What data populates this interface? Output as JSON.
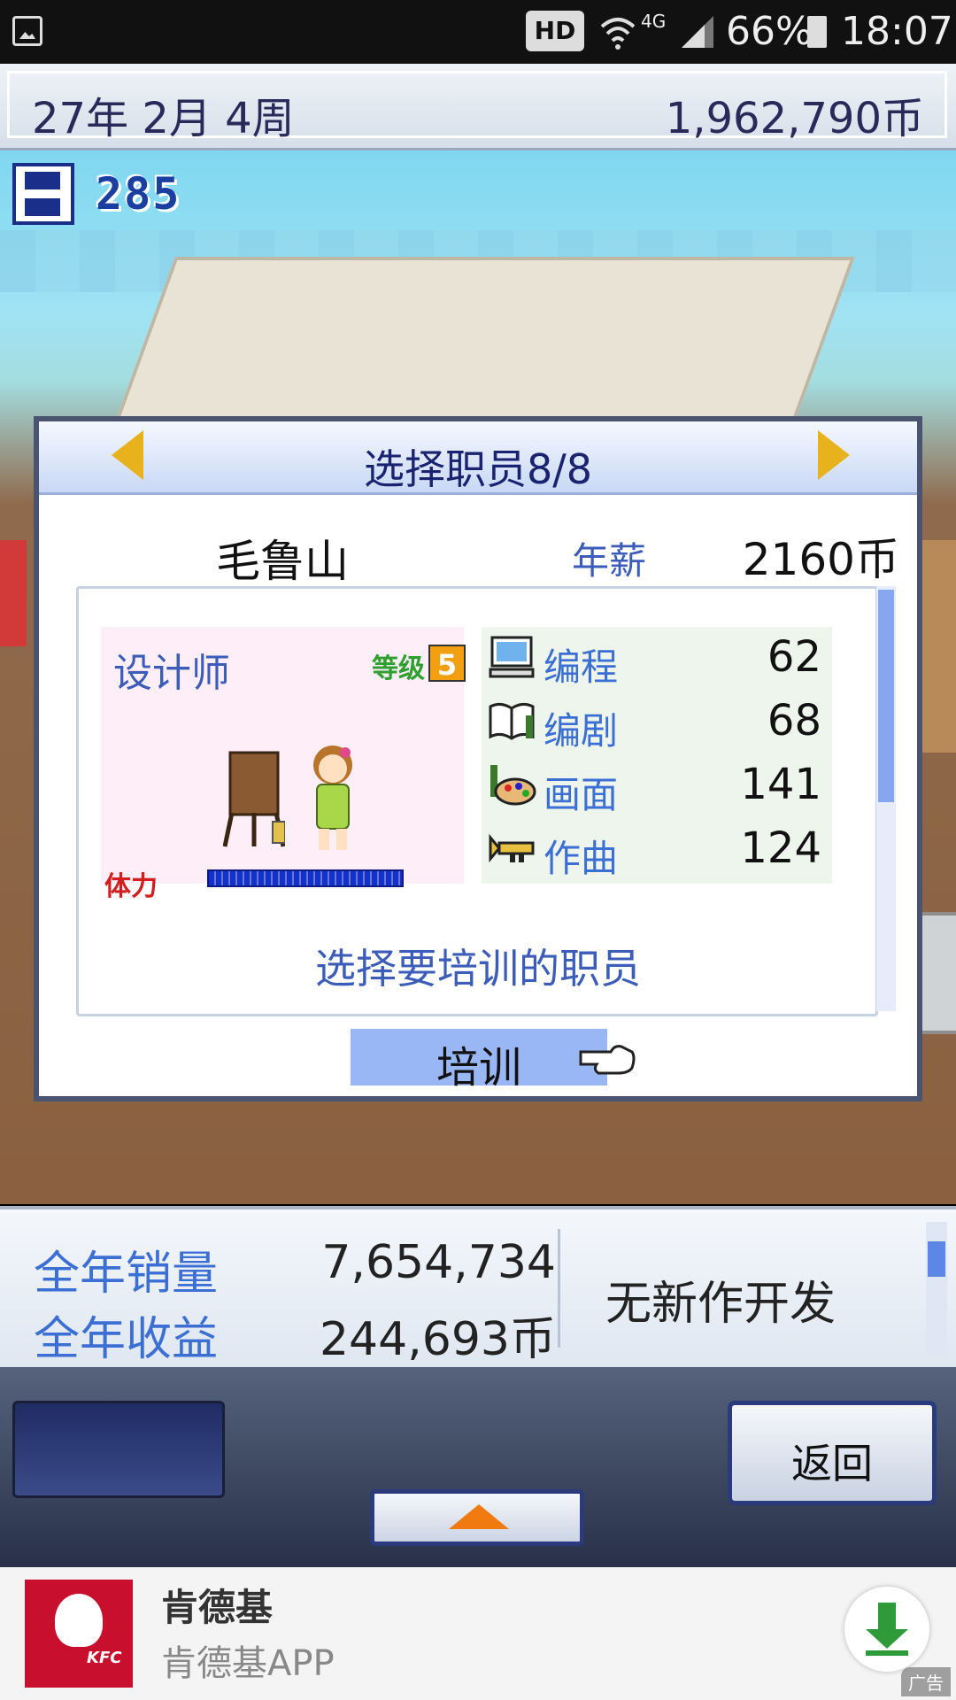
{
  "status_bar": {
    "hd": "HD",
    "network": "4G",
    "battery": "66%",
    "time": "18:07"
  },
  "top_bar": {
    "date": "27年 2月 4周",
    "money": "1,962,790币"
  },
  "save": {
    "count": "285"
  },
  "dialog": {
    "title": "选择职员8/8",
    "employee_name": "毛鲁山",
    "salary_label": "年薪",
    "salary_value": "2160币",
    "role": "设计师",
    "level_label": "等级",
    "level_value": "5",
    "stamina_label": "体力",
    "stats": [
      {
        "label": "编程",
        "value": "62",
        "icon": "computer-icon"
      },
      {
        "label": "编剧",
        "value": "68",
        "icon": "book-icon"
      },
      {
        "label": "画面",
        "value": "141",
        "icon": "palette-icon"
      },
      {
        "label": "作曲",
        "value": "124",
        "icon": "trumpet-icon"
      }
    ],
    "hint": "选择要培训的职员",
    "train_button": "培训"
  },
  "sales": {
    "annual_sales_label": "全年销量",
    "annual_sales_value": "7,654,734",
    "annual_revenue_label": "全年收益",
    "annual_revenue_value": "244,693币",
    "status": "无新作开发"
  },
  "controls": {
    "back": "返回"
  },
  "ad": {
    "title": "肯德基",
    "subtitle": "肯德基APP",
    "tag": "广告"
  },
  "colors": {
    "accent": "#3b5cb8",
    "highlight": "#99b7f5",
    "stamina": "#1530c8"
  }
}
